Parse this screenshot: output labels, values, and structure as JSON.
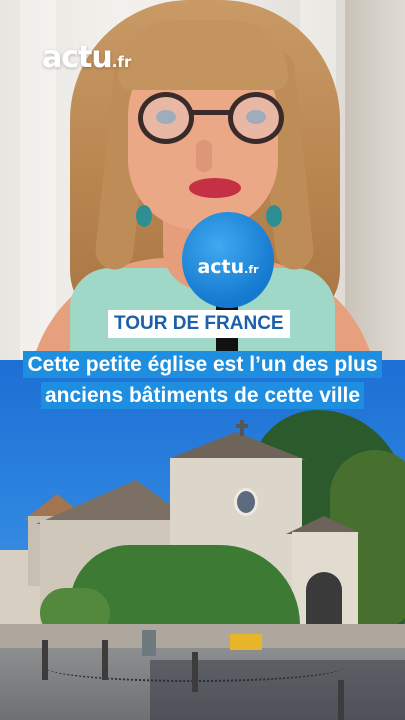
{
  "brand": {
    "logo_main": "actu",
    "logo_tld": ".fr"
  },
  "microphone": {
    "logo_main": "actu",
    "logo_tld": ".fr"
  },
  "category_tag": "TOUR DE FRANCE",
  "headline": {
    "line1": "Cette petite église est l’un des plus",
    "line2": "anciens bâtiments de cette ville"
  },
  "colors": {
    "accent_blue": "#1e8fe0",
    "tag_text": "#1d5fa8",
    "mic_blue": "#1579cf"
  }
}
